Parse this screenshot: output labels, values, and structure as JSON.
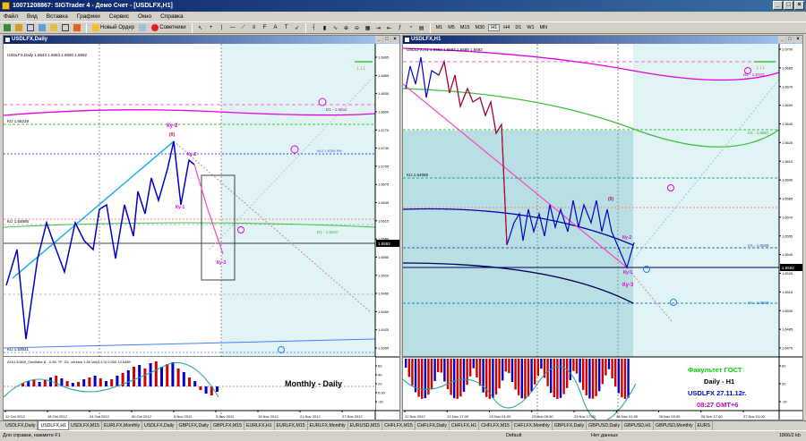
{
  "window": {
    "title": "10071208867: SIGTrader 4 - Демо Счет - [USDLFX,H1]"
  },
  "menu": [
    "Файл",
    "Вид",
    "Вставка",
    "Графики",
    "Сервис",
    "Окно",
    "Справка"
  ],
  "toolbar": {
    "new_order": "Новый Ордер",
    "advisors": "Советники",
    "timeframes": [
      "M1",
      "M5",
      "M15",
      "M30",
      "H1",
      "H4",
      "D1",
      "W1",
      "MN"
    ],
    "active_timeframe": "H1"
  },
  "left_chart": {
    "window_title": "USDLFX,Daily",
    "ohlc": "USDLFX,Daily 1.6643 1.6653 1.6590 1.6592",
    "price_ticks": [
      "1.6895",
      "1.6865",
      "1.6830",
      "1.6800",
      "1.6770",
      "1.6740",
      "1.6705",
      "1.6675",
      "1.6645",
      "1.6615",
      "1.6580",
      "1.6550",
      "1.6520",
      "1.6490",
      "1.6460",
      "1.6425",
      "1.6395"
    ],
    "current_price": "1.6592",
    "level_labels": {
      "kij_top": "KIJ 1.66219",
      "kij_mid": "KIJ 1.64995",
      "kij_low": "KIJ 1.63941",
      "d1": "D1 - 1.6652",
      "w2": "W-2 1.6764 RH",
      "d1b": "D1 - 1.6620"
    },
    "wave_labels": {
      "zero": "(0)",
      "ky1": "Ку-1",
      "ky2": "Ку-2",
      "ky2_top": "Ку-2",
      "ky3": "Ку-3"
    },
    "osc_label": "ATA1.EAN3_Oscillator 8 - 0.38, TF: D1, version 1.80  Val(3,2,0) 0.000  13.6489",
    "osc_ticks": [
      "60",
      "40",
      "20",
      "0.00",
      "-20"
    ],
    "date_ticks": [
      "12 Oct 2012",
      "18 Oct 2012",
      "24 Oct 2012",
      "30 Oct 2012",
      "5 Nov 2012",
      "9 Nov 2012",
      "15 Nov 2012",
      "21 Nov 2012",
      "27 Nov 2012"
    ],
    "caption": "Monthly - Daily"
  },
  "right_chart": {
    "window_title": "USDLFX,H1",
    "ohlc": "USDLFX,H1 1.6592 1.6594 1.6589 1.6592",
    "price_ticks": [
      "1.6700",
      "1.6685",
      "1.6670",
      "1.6650",
      "1.6640",
      "1.6625",
      "1.6610",
      "1.6600",
      "1.6585",
      "1.6570",
      "1.6555",
      "1.6540",
      "1.6525",
      "1.6515",
      "1.6500",
      "1.6485",
      "1.6475"
    ],
    "current_price": "1.6592",
    "level_labels": {
      "kij": "KIJ 1.64955",
      "d1_top": "D1 - 1.6703",
      "h1_mid": "H1 - 1.6667",
      "h1_a": "H1 - 1.6598",
      "h1_b": "H1 - 1.6568"
    },
    "wave_labels": {
      "zero": "(0)",
      "ky2": "Ку-2",
      "ky1": "Ку-1",
      "ky3": "Ку-3"
    },
    "date_ticks": [
      "22 Nov 2012",
      "22 Nov 17:00",
      "23 Nov 01:00",
      "23 Nov 09:00",
      "23 Nov 17:00",
      "26 Nov 01:00",
      "26 Nov 09:00",
      "26 Nov 17:00",
      "27 Nov 01:00"
    ],
    "osc_ticks": [
      "60",
      "20",
      "-20"
    ],
    "caption": {
      "line1": "Факультет ГОСТ",
      "line2": "Daily - H1",
      "line3": "USDLFX 27.11.12г.",
      "line4": "08:27  GMT+6"
    }
  },
  "tabs": [
    "USDLFX,Daily",
    "USDLFX,H1",
    "USDLFX,M15",
    "EURLFX,Monthly",
    "USDLFX,Daily",
    "GBPLFX,Daily",
    "GBPLFX,M15",
    "EURLFX,H1",
    "EURLFX,M15",
    "EURLFX,Monthly",
    "EURUSD,M15",
    "CHFLFX,M15",
    "CHFLFX,Daily",
    "CHFLFX,H1",
    "CHFLFX,M15",
    "CHFLFX,Monthly",
    "GBPLFX,Daily",
    "GBPUSD,Daily",
    "GBPUSD,H1",
    "GBPUSD,Monthly",
    "EURS"
  ],
  "active_tab": 1,
  "status": {
    "help": "Для справки, нажмите F1",
    "profile": "Default",
    "nodata": "Нет данных",
    "traffic": "1866/2 kb"
  },
  "colors": {
    "blue_line": "#0000c8",
    "red_line": "#d00000",
    "pink": "#ff40c0",
    "magenta": "#e000e0",
    "cyan": "#30c0ff",
    "green": "#40c040",
    "navy": "#00005a",
    "teal_fill": "#c0e8ec",
    "caption_green": "#00d000",
    "caption_blue": "#0000d0",
    "caption_purple": "#c000c0"
  }
}
